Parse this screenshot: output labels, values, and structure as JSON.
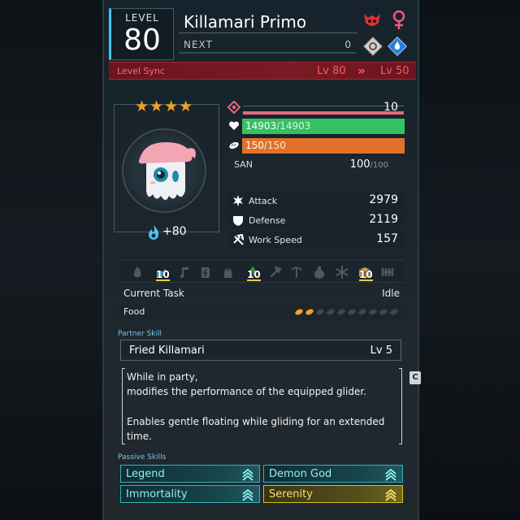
{
  "header": {
    "level_label": "LEVEL",
    "level": "80",
    "name": "Killamari Primo",
    "next_label": "NEXT",
    "next_value": "0",
    "icons": [
      "boss-icon",
      "female-gender-icon",
      "neutral-element-icon",
      "water-element-icon"
    ]
  },
  "level_sync": {
    "label": "Level Sync",
    "from": "Lv 80",
    "arrow": "»",
    "to": "Lv 50"
  },
  "portrait": {
    "stars": "★★★★",
    "star_count": 4,
    "trust_bonus": "+80"
  },
  "stats": {
    "rank": "10",
    "hp_current": "14903",
    "hp_max": "/14903",
    "hp_fraction": 1.0,
    "food_current": "150",
    "food_max": "/150",
    "food_fraction": 1.0,
    "san_label": "SAN",
    "san_current": "100",
    "san_max": "/100",
    "attack_label": "Attack",
    "attack": "2979",
    "defense_label": "Defense",
    "defense": "2119",
    "work_speed_label": "Work Speed",
    "work_speed": "157"
  },
  "work_suitability": {
    "kindling": "",
    "watering": "10",
    "planting": "",
    "electricity": "",
    "handiwork": "",
    "gathering": "10",
    "lumbering": "",
    "mining": "",
    "medicine": "",
    "cooling": "",
    "transporting": "10",
    "farming": ""
  },
  "task": {
    "label": "Current Task",
    "value": "Idle",
    "food_label": "Food",
    "food_filled": 2,
    "food_total": 10
  },
  "partner_skill": {
    "section_label": "Partner Skill",
    "name": "Fried Killamari",
    "level": "Lv  5",
    "desc_line1": "While in party,",
    "desc_line2": "modifies the performance of the equipped glider.",
    "desc_line3": "Enables gentle floating while gliding for an extended",
    "desc_line4": "time."
  },
  "passive_skills": {
    "section_label": "Passive Skills",
    "skill1": "Legend",
    "skill2": "Demon God",
    "skill3": "Immortality",
    "skill4": "Serenity"
  },
  "colors": {
    "hp": "#35c062",
    "food": "#e2722a",
    "sync": "#7a1a24",
    "accent": "#3fc7ee",
    "rank": "#e46a7a",
    "teal_skill": "#2fb3b8",
    "gold_skill": "#d8c020"
  }
}
